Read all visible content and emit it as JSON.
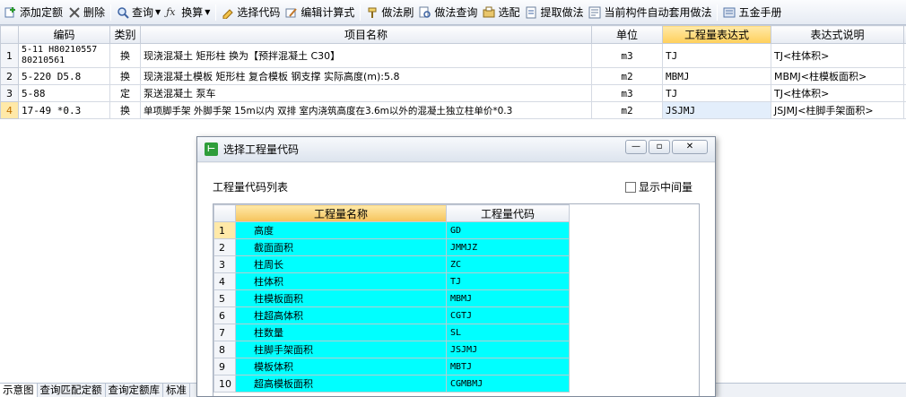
{
  "toolbar": {
    "items": [
      {
        "label": "添加定额",
        "icon": "add-quota-icon"
      },
      {
        "label": "删除",
        "icon": "delete-icon"
      },
      {
        "label": "查询",
        "icon": "search-icon"
      },
      {
        "label": "换算",
        "icon": "fx-icon"
      },
      {
        "label": "选择代码",
        "icon": "select-code-icon"
      },
      {
        "label": "编辑计算式",
        "icon": "edit-formula-icon"
      },
      {
        "label": "做法刷",
        "icon": "brush-icon"
      },
      {
        "label": "做法查询",
        "icon": "method-search-icon"
      },
      {
        "label": "选配",
        "icon": "match-icon"
      },
      {
        "label": "提取做法",
        "icon": "extract-icon"
      },
      {
        "label": "当前构件自动套用做法",
        "icon": "auto-apply-icon"
      },
      {
        "label": "五金手册",
        "icon": "manual-icon"
      }
    ]
  },
  "grid": {
    "headers": [
      "编码",
      "类别",
      "项目名称",
      "单位",
      "工程量表达式",
      "表达式说明"
    ],
    "rows": [
      {
        "num": "1",
        "code": "5-11 H80210557 80210561",
        "type": "换",
        "name": "现浇混凝土 矩形柱 换为【预拌混凝土 C30】",
        "unit": "m3",
        "expr": "TJ",
        "desc": "TJ<柱体积>"
      },
      {
        "num": "2",
        "code": "5-220 D5.8",
        "type": "换",
        "name": "现浇混凝土模板 矩形柱 复合模板 钢支撑 实际高度(m):5.8",
        "unit": "m2",
        "expr": "MBMJ",
        "desc": "MBMJ<柱模板面积>"
      },
      {
        "num": "3",
        "code": "5-88",
        "type": "定",
        "name": "泵送混凝土 泵车",
        "unit": "m3",
        "expr": "TJ",
        "desc": "TJ<柱体积>"
      },
      {
        "num": "4",
        "code": "17-49 *0.3",
        "type": "换",
        "name": "单项脚手架 外脚手架 15m以内 双排 室内浇筑高度在3.6m以外的混凝土独立柱单价*0.3",
        "unit": "m2",
        "expr": "JSJMJ",
        "desc": "JSJMJ<柱脚手架面积>"
      }
    ]
  },
  "bottom_tabs": [
    "示意图",
    "查询匹配定额",
    "查询定额库",
    "标准"
  ],
  "dialog": {
    "title": "选择工程量代码",
    "list_label": "工程量代码列表",
    "checkbox_label": "显示中间量",
    "checkbox_checked": false,
    "headers": [
      "工程量名称",
      "工程量代码"
    ],
    "rows": [
      {
        "num": "1",
        "name": "高度",
        "code": "GD"
      },
      {
        "num": "2",
        "name": "截面面积",
        "code": "JMMJZ"
      },
      {
        "num": "3",
        "name": "柱周长",
        "code": "ZC"
      },
      {
        "num": "4",
        "name": "柱体积",
        "code": "TJ"
      },
      {
        "num": "5",
        "name": "柱模板面积",
        "code": "MBMJ"
      },
      {
        "num": "6",
        "name": "柱超高体积",
        "code": "CGTJ"
      },
      {
        "num": "7",
        "name": "柱数量",
        "code": "SL"
      },
      {
        "num": "8",
        "name": "柱脚手架面积",
        "code": "JSJMJ"
      },
      {
        "num": "9",
        "name": "模板体积",
        "code": "MBTJ"
      },
      {
        "num": "10",
        "name": "超高模板面积",
        "code": "CGMBMJ"
      }
    ]
  },
  "colors": {
    "highlight": "#00ffff",
    "header_selected": "#ffd36b"
  }
}
